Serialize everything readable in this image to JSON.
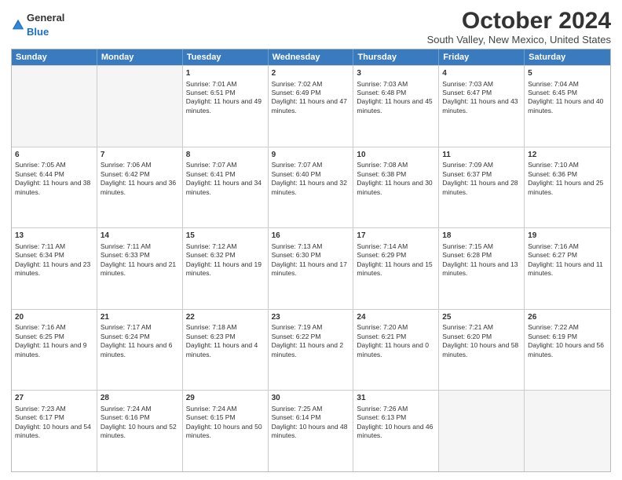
{
  "logo": {
    "general": "General",
    "blue": "Blue"
  },
  "title": "October 2024",
  "subtitle": "South Valley, New Mexico, United States",
  "header_days": [
    "Sunday",
    "Monday",
    "Tuesday",
    "Wednesday",
    "Thursday",
    "Friday",
    "Saturday"
  ],
  "weeks": [
    [
      {
        "day": "",
        "info": ""
      },
      {
        "day": "",
        "info": ""
      },
      {
        "day": "1",
        "info": "Sunrise: 7:01 AM\nSunset: 6:51 PM\nDaylight: 11 hours and 49 minutes."
      },
      {
        "day": "2",
        "info": "Sunrise: 7:02 AM\nSunset: 6:49 PM\nDaylight: 11 hours and 47 minutes."
      },
      {
        "day": "3",
        "info": "Sunrise: 7:03 AM\nSunset: 6:48 PM\nDaylight: 11 hours and 45 minutes."
      },
      {
        "day": "4",
        "info": "Sunrise: 7:03 AM\nSunset: 6:47 PM\nDaylight: 11 hours and 43 minutes."
      },
      {
        "day": "5",
        "info": "Sunrise: 7:04 AM\nSunset: 6:45 PM\nDaylight: 11 hours and 40 minutes."
      }
    ],
    [
      {
        "day": "6",
        "info": "Sunrise: 7:05 AM\nSunset: 6:44 PM\nDaylight: 11 hours and 38 minutes."
      },
      {
        "day": "7",
        "info": "Sunrise: 7:06 AM\nSunset: 6:42 PM\nDaylight: 11 hours and 36 minutes."
      },
      {
        "day": "8",
        "info": "Sunrise: 7:07 AM\nSunset: 6:41 PM\nDaylight: 11 hours and 34 minutes."
      },
      {
        "day": "9",
        "info": "Sunrise: 7:07 AM\nSunset: 6:40 PM\nDaylight: 11 hours and 32 minutes."
      },
      {
        "day": "10",
        "info": "Sunrise: 7:08 AM\nSunset: 6:38 PM\nDaylight: 11 hours and 30 minutes."
      },
      {
        "day": "11",
        "info": "Sunrise: 7:09 AM\nSunset: 6:37 PM\nDaylight: 11 hours and 28 minutes."
      },
      {
        "day": "12",
        "info": "Sunrise: 7:10 AM\nSunset: 6:36 PM\nDaylight: 11 hours and 25 minutes."
      }
    ],
    [
      {
        "day": "13",
        "info": "Sunrise: 7:11 AM\nSunset: 6:34 PM\nDaylight: 11 hours and 23 minutes."
      },
      {
        "day": "14",
        "info": "Sunrise: 7:11 AM\nSunset: 6:33 PM\nDaylight: 11 hours and 21 minutes."
      },
      {
        "day": "15",
        "info": "Sunrise: 7:12 AM\nSunset: 6:32 PM\nDaylight: 11 hours and 19 minutes."
      },
      {
        "day": "16",
        "info": "Sunrise: 7:13 AM\nSunset: 6:30 PM\nDaylight: 11 hours and 17 minutes."
      },
      {
        "day": "17",
        "info": "Sunrise: 7:14 AM\nSunset: 6:29 PM\nDaylight: 11 hours and 15 minutes."
      },
      {
        "day": "18",
        "info": "Sunrise: 7:15 AM\nSunset: 6:28 PM\nDaylight: 11 hours and 13 minutes."
      },
      {
        "day": "19",
        "info": "Sunrise: 7:16 AM\nSunset: 6:27 PM\nDaylight: 11 hours and 11 minutes."
      }
    ],
    [
      {
        "day": "20",
        "info": "Sunrise: 7:16 AM\nSunset: 6:25 PM\nDaylight: 11 hours and 9 minutes."
      },
      {
        "day": "21",
        "info": "Sunrise: 7:17 AM\nSunset: 6:24 PM\nDaylight: 11 hours and 6 minutes."
      },
      {
        "day": "22",
        "info": "Sunrise: 7:18 AM\nSunset: 6:23 PM\nDaylight: 11 hours and 4 minutes."
      },
      {
        "day": "23",
        "info": "Sunrise: 7:19 AM\nSunset: 6:22 PM\nDaylight: 11 hours and 2 minutes."
      },
      {
        "day": "24",
        "info": "Sunrise: 7:20 AM\nSunset: 6:21 PM\nDaylight: 11 hours and 0 minutes."
      },
      {
        "day": "25",
        "info": "Sunrise: 7:21 AM\nSunset: 6:20 PM\nDaylight: 10 hours and 58 minutes."
      },
      {
        "day": "26",
        "info": "Sunrise: 7:22 AM\nSunset: 6:19 PM\nDaylight: 10 hours and 56 minutes."
      }
    ],
    [
      {
        "day": "27",
        "info": "Sunrise: 7:23 AM\nSunset: 6:17 PM\nDaylight: 10 hours and 54 minutes."
      },
      {
        "day": "28",
        "info": "Sunrise: 7:24 AM\nSunset: 6:16 PM\nDaylight: 10 hours and 52 minutes."
      },
      {
        "day": "29",
        "info": "Sunrise: 7:24 AM\nSunset: 6:15 PM\nDaylight: 10 hours and 50 minutes."
      },
      {
        "day": "30",
        "info": "Sunrise: 7:25 AM\nSunset: 6:14 PM\nDaylight: 10 hours and 48 minutes."
      },
      {
        "day": "31",
        "info": "Sunrise: 7:26 AM\nSunset: 6:13 PM\nDaylight: 10 hours and 46 minutes."
      },
      {
        "day": "",
        "info": ""
      },
      {
        "day": "",
        "info": ""
      }
    ]
  ]
}
